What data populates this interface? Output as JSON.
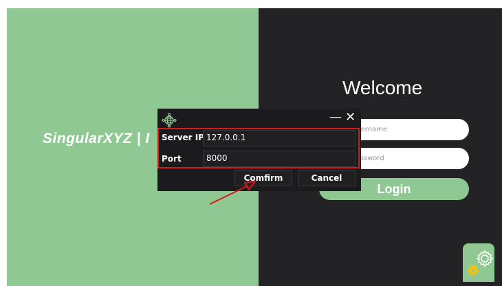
{
  "brand": {
    "text": "SingularXYZ | I"
  },
  "login": {
    "welcome": "Welcome",
    "username_placeholder": "Username",
    "password_placeholder": "Password",
    "login_label": "Login"
  },
  "dialog": {
    "server_ip_label": "Server IP",
    "server_ip_value": "127.0.0.1",
    "port_label": "Port",
    "port_value": "8000",
    "confirm_label": "Comfirm",
    "cancel_label": "Cancel",
    "minimize_symbol": "—",
    "close_symbol": "✕",
    "icon": "network-globe-icon"
  },
  "settings": {
    "icon": "gear-icon"
  },
  "colors": {
    "brand_green": "#8fc893",
    "dark_panel": "#232326",
    "annotation_red": "#d7191c"
  }
}
